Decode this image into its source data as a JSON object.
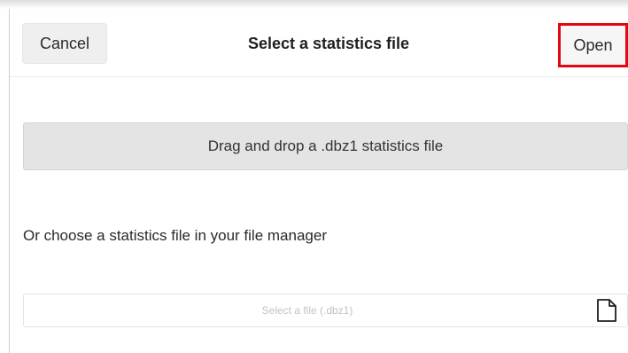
{
  "header": {
    "cancel_label": "Cancel",
    "title": "Select a statistics file",
    "open_label": "Open"
  },
  "dropzone": {
    "label": "Drag and drop a .dbz1 statistics file"
  },
  "chooser": {
    "label": "Or choose a statistics file in your file manager",
    "placeholder": "Select a file (.dbz1)",
    "icon": "file-icon"
  },
  "colors": {
    "highlight": "#e30613",
    "dropzone_bg": "#e4e4e4"
  }
}
